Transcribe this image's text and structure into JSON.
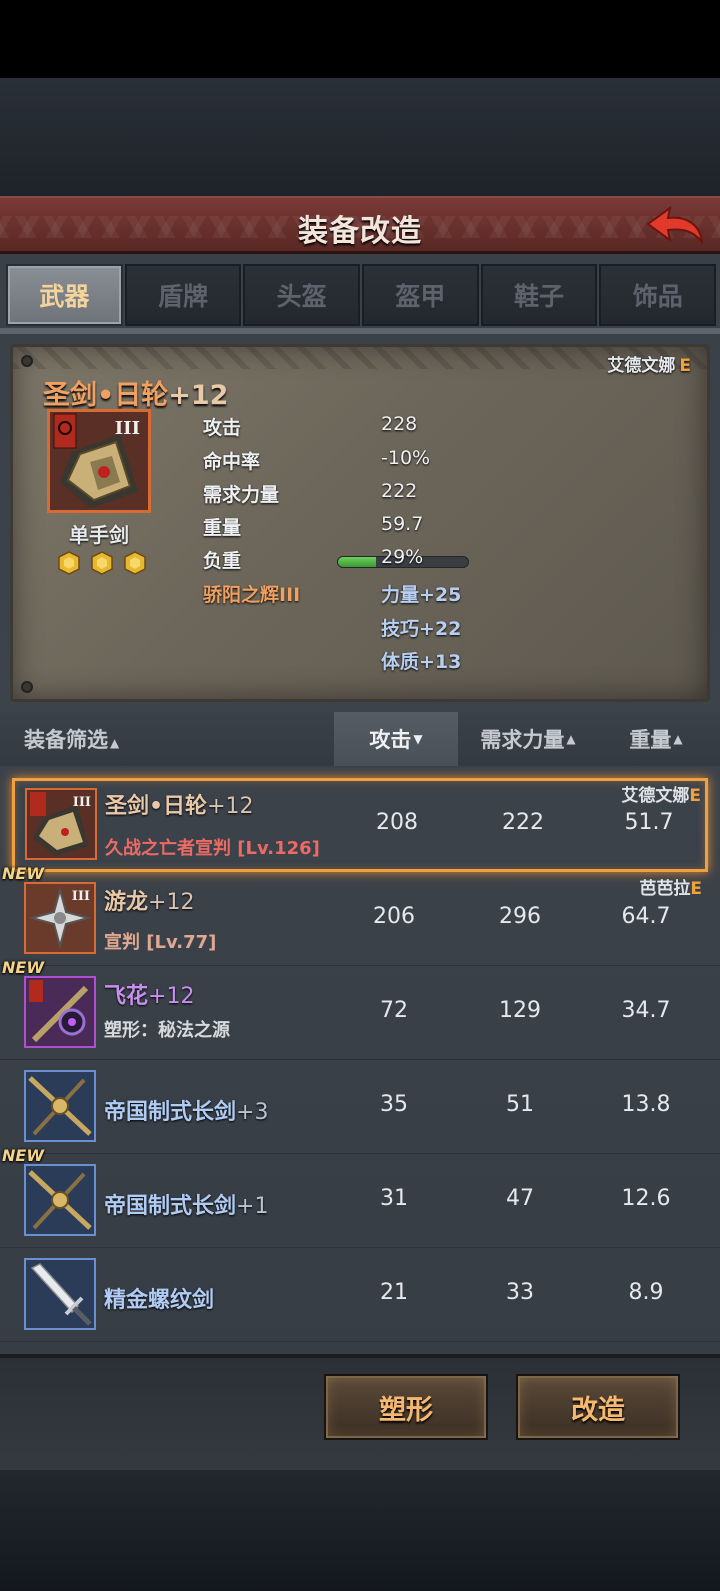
{
  "header": {
    "title": "装备改造"
  },
  "tabs": [
    {
      "label": "武器",
      "active": true
    },
    {
      "label": "盾牌",
      "active": false
    },
    {
      "label": "头盔",
      "active": false
    },
    {
      "label": "盔甲",
      "active": false
    },
    {
      "label": "鞋子",
      "active": false
    },
    {
      "label": "饰品",
      "active": false
    }
  ],
  "detail": {
    "owner": "艾德文娜",
    "owner_grade": "E",
    "name": "圣剑•日轮",
    "plus": "+12",
    "rank": "III",
    "weapon_type": "单手剑",
    "gem_count": 3,
    "stats": [
      {
        "label": "攻击",
        "value": "228"
      },
      {
        "label": "命中率",
        "value": "-10%"
      },
      {
        "label": "需求力量",
        "value": "222"
      },
      {
        "label": "重量",
        "value": "59.7"
      },
      {
        "label": "负重",
        "value": "29%"
      }
    ],
    "load_fraction": 0.29,
    "skill": {
      "label": "骄阳之辉III",
      "bonuses": [
        "力量+25",
        "技巧+22",
        "体质+13"
      ]
    }
  },
  "sort": {
    "filter": "装备筛选",
    "columns": [
      {
        "label": "攻击",
        "active": true,
        "arrow": "▼"
      },
      {
        "label": "需求力量",
        "active": false,
        "arrow": "▲"
      },
      {
        "label": "重量",
        "active": false,
        "arrow": "▲"
      }
    ],
    "filter_arrow": "▲"
  },
  "list": [
    {
      "name": "圣剑•日轮",
      "plus": "+12",
      "sub": "久战之亡者宣判 [Lv.126]",
      "owner": "艾德文娜",
      "grade": "E",
      "atk": "208",
      "str": "222",
      "weight": "51.7",
      "is_new": false,
      "selected": true,
      "rarity": "orange",
      "rank": "III"
    },
    {
      "name": "游龙",
      "plus": "+12",
      "sub": "宣判 [Lv.77]",
      "owner": "芭芭拉",
      "grade": "E",
      "atk": "206",
      "str": "296",
      "weight": "64.7",
      "is_new": true,
      "selected": false,
      "rarity": "orange",
      "rank": "III"
    },
    {
      "name": "飞花",
      "plus": "+12",
      "sub": "塑形：秘法之源",
      "owner": "",
      "grade": "",
      "atk": "72",
      "str": "129",
      "weight": "34.7",
      "is_new": true,
      "selected": false,
      "rarity": "purple",
      "rank": ""
    },
    {
      "name": "帝国制式长剑",
      "plus": "+3",
      "sub": "",
      "owner": "",
      "grade": "",
      "atk": "35",
      "str": "51",
      "weight": "13.8",
      "is_new": false,
      "selected": false,
      "rarity": "blue",
      "rank": ""
    },
    {
      "name": "帝国制式长剑",
      "plus": "+1",
      "sub": "",
      "owner": "",
      "grade": "",
      "atk": "31",
      "str": "47",
      "weight": "12.6",
      "is_new": true,
      "selected": false,
      "rarity": "blue",
      "rank": ""
    },
    {
      "name": "精金螺纹剑",
      "plus": "",
      "sub": "",
      "owner": "",
      "grade": "",
      "atk": "21",
      "str": "33",
      "weight": "8.9",
      "is_new": false,
      "selected": false,
      "rarity": "blue",
      "rank": ""
    }
  ],
  "new_label": "NEW",
  "buttons": {
    "shape": "塑形",
    "modify": "改造"
  },
  "colors": {
    "accent_orange": "#f0a060",
    "selected_border": "#f0a040",
    "header_red": "#6a302c",
    "load_green": "#4fb040"
  }
}
